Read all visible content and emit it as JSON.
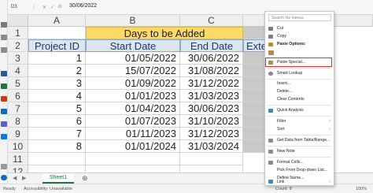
{
  "formula_bar": {
    "name_box": "D3",
    "formula_value": "30/06/2022"
  },
  "sheet": {
    "columns": [
      "A",
      "B",
      "C",
      "D"
    ],
    "rows": [
      "1",
      "2",
      "3",
      "4",
      "5",
      "6",
      "7",
      "8",
      "9",
      "10",
      "11",
      "12"
    ],
    "merged_header": "Days to be Added",
    "headers": [
      "Project ID",
      "Start Date",
      "End Date",
      "Extende"
    ],
    "data": [
      [
        "1",
        "01/05/2022",
        "30/06/2022"
      ],
      [
        "2",
        "15/07/2022",
        "31/08/2022"
      ],
      [
        "3",
        "01/09/2022",
        "31/12/2022"
      ],
      [
        "4",
        "01/01/2023",
        "31/03/2023"
      ],
      [
        "5",
        "01/04/2023",
        "30/06/2023"
      ],
      [
        "6",
        "01/07/2023",
        "31/10/2023"
      ],
      [
        "7",
        "01/11/2023",
        "31/12/2023"
      ],
      [
        "8",
        "01/01/2024",
        "31/03/2024"
      ]
    ]
  },
  "sheet_tab": "Sheet1",
  "status": {
    "ready": "Ready",
    "accessibility": "Accessibility: Unavailable",
    "count": "Count: 8",
    "zoom": "100%"
  },
  "context_menu": {
    "search_placeholder": "Search the menus",
    "cut": "Cut",
    "copy": "Copy",
    "paste_options": "Paste Options:",
    "paste_special": "Paste Special...",
    "smart_lookup": "Smart Lookup",
    "insert": "Insert...",
    "delete": "Delete...",
    "clear_contents": "Clear Contents",
    "quick_analysis": "Quick Analysis",
    "filter": "Filter",
    "sort": "Sort",
    "get_data": "Get Data from Table/Range...",
    "new_note": "New Note",
    "format_cells": "Format Cells...",
    "pick_list": "Pick From Drop-down List...",
    "define_name": "Define Name...",
    "link": "Link"
  },
  "colors": {
    "accent_green": "#217346",
    "header_yellow": "#ffd966",
    "highlight_red": "#e03030",
    "shaded_cell": "#c9c9c9"
  }
}
